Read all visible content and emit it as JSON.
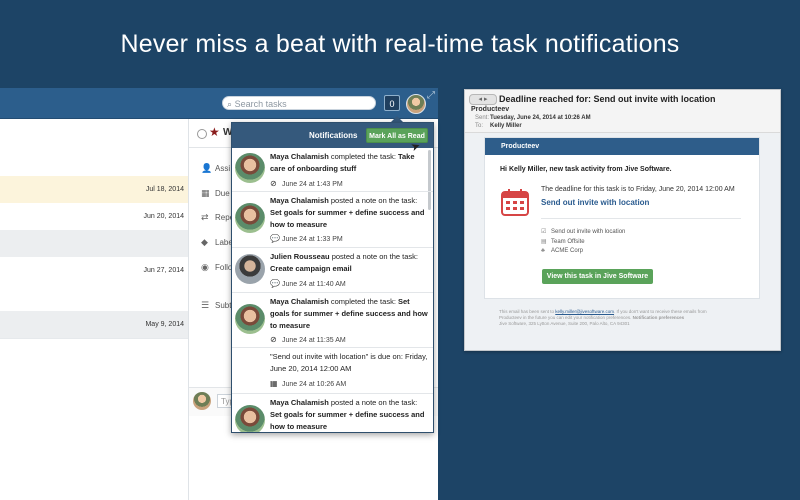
{
  "headline": "Never miss a beat with real-time task notifications",
  "app": {
    "search_placeholder": "Search tasks",
    "notification_count": "0",
    "list_dates": [
      "Jul 18, 2014",
      "Jun 20, 2014",
      "Jun 27, 2014",
      "May 9, 2014"
    ],
    "detail_title_partial": "W",
    "fields": [
      {
        "icon": "person-icon",
        "glyph": "👤",
        "label": "Assi"
      },
      {
        "icon": "calendar-icon",
        "glyph": "▦",
        "label": "Due"
      },
      {
        "icon": "repeat-icon",
        "glyph": "⇄",
        "label": "Repe"
      },
      {
        "icon": "tag-icon",
        "glyph": "◆",
        "label": "Labe"
      },
      {
        "icon": "follow-icon",
        "glyph": "◉",
        "label": "Follo"
      },
      {
        "icon": "subtasks-icon",
        "glyph": "☰",
        "label": "Subt"
      }
    ],
    "comment_placeholder": "Typ"
  },
  "notifications": {
    "title": "Notifications",
    "mark_all_label": "Mark All as Read",
    "items": [
      {
        "actor": "Maya Chalamish",
        "action": " completed the task: ",
        "target": "Take care of onboarding stuff",
        "time": "June 24 at 1:43 PM",
        "icon": "check-circle-icon",
        "glyph": "⊘"
      },
      {
        "actor": "Maya Chalamish",
        "action": " posted a note on the task: ",
        "target": "Set goals for summer + define success and how to measure",
        "time": "June 24 at 1:33 PM",
        "icon": "speech-bubble-icon",
        "glyph": "💬"
      },
      {
        "actor": "Julien Rousseau",
        "action": " posted a note on the task: ",
        "target": "Create campaign email",
        "time": "June 24 at 11:40 AM",
        "icon": "speech-bubble-icon",
        "glyph": "💬"
      },
      {
        "actor": "Maya Chalamish",
        "action": " completed the task: ",
        "target": "Set goals for summer + define success and how to measure",
        "time": "June 24 at 11:35 AM",
        "icon": "check-circle-icon",
        "glyph": "⊘"
      },
      {
        "actor": "",
        "action": "\"Send out invite with location\" is due on: Friday, June 20, 2014 12:00 AM",
        "target": "",
        "time": "June 24 at 10:26 AM",
        "icon": "calendar-icon",
        "glyph": "▦"
      },
      {
        "actor": "Maya Chalamish",
        "action": " posted a note on the task: ",
        "target": "Set goals for summer + define success and how to measure",
        "time": "",
        "icon": "",
        "glyph": ""
      }
    ]
  },
  "email": {
    "back_label": "◂ ▸",
    "subject": "Deadline reached for: Send out invite with location",
    "from": "Producteev",
    "sent_label": "Sent:",
    "sent_value": "Tuesday, June 24, 2014 at 10:26 AM",
    "to_label": "To:",
    "to_value": "Kelly Miller",
    "brand": "Producteev",
    "greeting": "Hi Kelly Miller, new task activity from Jive Software.",
    "deadline_text": "The deadline for this task is to Friday, June 20, 2014 12:00 AM",
    "task_title": "Send out invite with location",
    "info": [
      {
        "icon": "checkbox-icon",
        "glyph": "☑",
        "text": "Send out invite with location"
      },
      {
        "icon": "book-icon",
        "glyph": "▤",
        "text": "Team Offsite"
      },
      {
        "icon": "org-icon",
        "glyph": "♣",
        "text": "ACME Corp"
      }
    ],
    "button_label": "View this task in Jive Software",
    "footer_line1_a": "This email has been sent to ",
    "footer_link": "kelly.miller@jivesoftware.com",
    "footer_line1_b": ". If you don't want to receive these emails from",
    "footer_line2": "Producteev in the future you can edit your notification preferences.",
    "footer_line2_bold": "Notification preferences",
    "footer_line3": "Jive Software, 325 Lytton Avenue, Suite 200, Palo Alto, CA 94301"
  },
  "colors": {
    "background": "#1d4466",
    "topbar": "#2c5e8c",
    "accent_green": "#5aa35a",
    "link_blue": "#2a5b8f",
    "calendar_red": "#d64545"
  }
}
